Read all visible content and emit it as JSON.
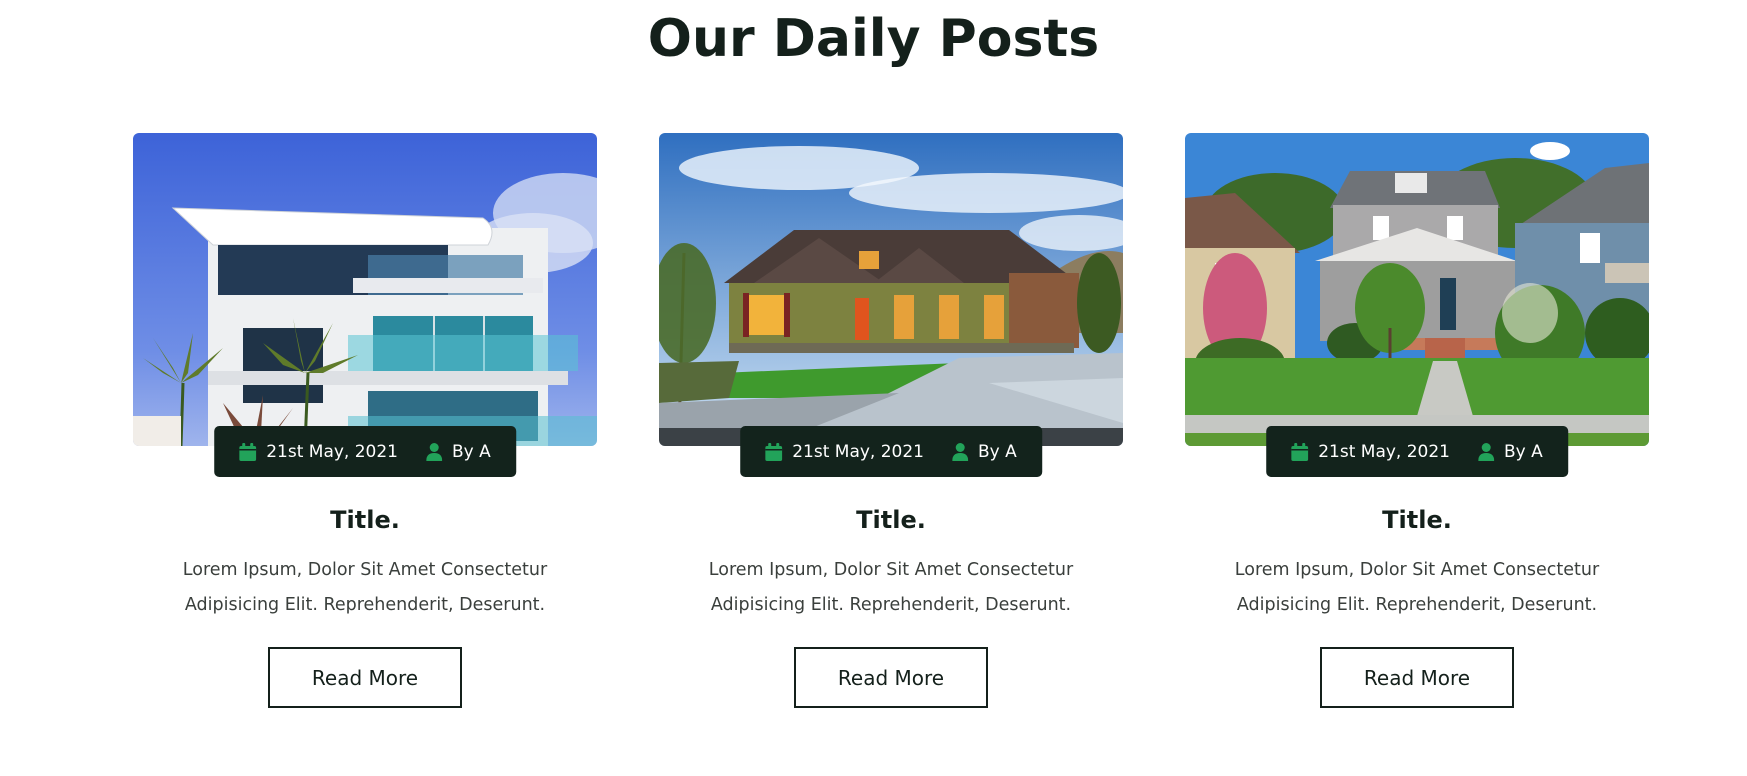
{
  "section": {
    "title": "Our Daily Posts"
  },
  "posts": [
    {
      "image_alt": "Modern white house with glass balconies",
      "date": "21st May, 2021",
      "author": "By A",
      "title": "Title.",
      "excerpt": "Lorem Ipsum, Dolor Sit Amet Consectetur Adipisicing Elit. Reprehenderit, Deserunt.",
      "button_label": "Read More"
    },
    {
      "image_alt": "Suburban house with lawn and driveway",
      "date": "21st May, 2021",
      "author": "By A",
      "title": "Title.",
      "excerpt": "Lorem Ipsum, Dolor Sit Amet Consectetur Adipisicing Elit. Reprehenderit, Deserunt.",
      "button_label": "Read More"
    },
    {
      "image_alt": "Two-storey houses with front yards and trees",
      "date": "21st May, 2021",
      "author": "By A",
      "title": "Title.",
      "excerpt": "Lorem Ipsum, Dolor Sit Amet Consectetur Adipisicing Elit. Reprehenderit, Deserunt.",
      "button_label": "Read More"
    }
  ],
  "icons": {
    "date": "calendar-icon",
    "author": "user-icon"
  },
  "colors": {
    "heading": "#14201b",
    "meta_bg": "#13231c",
    "icon_accent": "#22a35a",
    "body_text": "#3a3f3c",
    "button_border": "#14201b"
  }
}
